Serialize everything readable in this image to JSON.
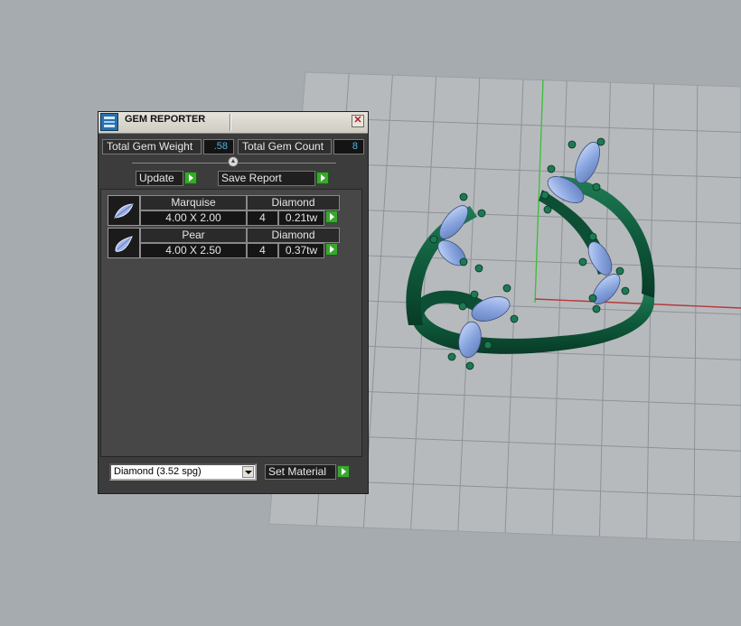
{
  "panel": {
    "title": "GEM REPORTER",
    "close_glyph": "✕",
    "total_weight_label": "Total Gem Weight",
    "total_weight_value": ".58",
    "total_count_label": "Total Gem Count",
    "total_count_value": "8",
    "update_label": "Update",
    "save_report_label": "Save Report",
    "gems": [
      {
        "shape": "Marquise",
        "material": "Diamond",
        "size": "4.00 X 2.00",
        "count": "4",
        "weight": "0.21tw"
      },
      {
        "shape": "Pear",
        "material": "Diamond",
        "size": "4.00 X 2.50",
        "count": "4",
        "weight": "0.37tw"
      }
    ],
    "material_select_value": "Diamond    (3.52 spg)",
    "set_material_label": "Set Material"
  },
  "icons": {
    "app": "gem-reporter-icon",
    "close": "close-icon",
    "go": "play-arrow-icon",
    "marquise": "marquise-gem-icon",
    "pear": "pear-gem-icon",
    "dropdown": "chevron-down-icon"
  },
  "colors": {
    "viewport_bg": "#a6abb0",
    "grid_line": "#8e9297",
    "axis_green": "#3fbf3f",
    "axis_red": "#b23a3a",
    "ring_metal": "#0f5a3c",
    "gem": "#8aa6e0",
    "go_button": "#3aa72e",
    "value_text": "#4fb3e6"
  }
}
